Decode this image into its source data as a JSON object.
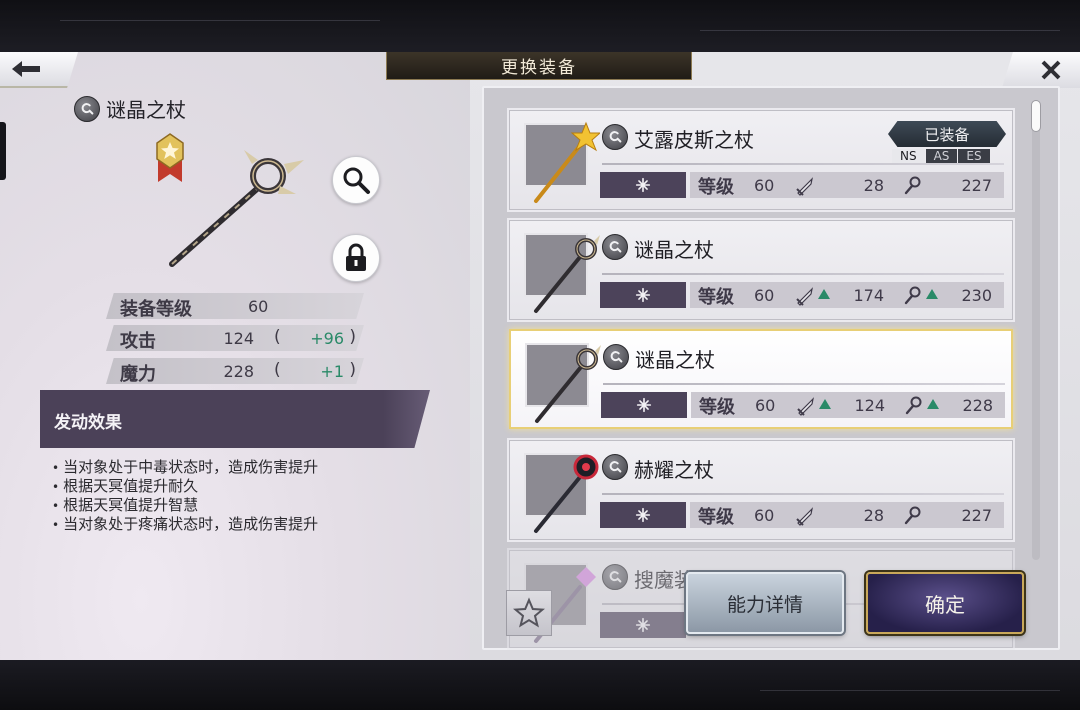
{
  "screen": {
    "title": "更换装备"
  },
  "selected_item": {
    "name": "谜晶之杖",
    "stats": [
      {
        "label": "装备等级",
        "value": "60",
        "diff": ""
      },
      {
        "label": "攻击",
        "value": "124",
        "diff": "+96"
      },
      {
        "label": "魔力",
        "value": "228",
        "diff": "+1"
      }
    ],
    "paren_open": "(",
    "paren_close": ")",
    "effect_title": "发动效果",
    "effects": [
      "当对象处于中毒状态时，造成伤害提升",
      "根据天冥值提升耐久",
      "根据天冥值提升智慧",
      "当对象处于疼痛状态时，造成伤害提升"
    ]
  },
  "list": {
    "items": [
      {
        "name": "艾露皮斯之杖",
        "level_label": "等级",
        "level": "60",
        "attack": "28",
        "magic": "227",
        "equipped_label": "已装备",
        "tags": [
          "NS",
          "AS",
          "ES"
        ]
      },
      {
        "name": "谜晶之杖",
        "level_label": "等级",
        "level": "60",
        "attack": "174",
        "magic": "230"
      },
      {
        "name": "谜晶之杖",
        "level_label": "等级",
        "level": "60",
        "attack": "124",
        "magic": "228"
      },
      {
        "name": "赫耀之杖",
        "level_label": "等级",
        "level": "60",
        "attack": "28",
        "magic": "227"
      },
      {
        "name": "搜魔装之杖"
      }
    ]
  },
  "buttons": {
    "detail": "能力详情",
    "confirm": "确定"
  },
  "icons": {
    "back": "back-arrow-icon",
    "close": "close-icon",
    "search": "magnifier-icon",
    "lock": "lock-icon",
    "favorite": "star-icon",
    "attack": "sword-icon",
    "magic": "staff-icon",
    "element": "sparkle-icon",
    "up": "up-arrow-icon"
  },
  "colors": {
    "accent_purple": "#4b4158",
    "gold_border": "#e8cf76",
    "positive_green": "#2a8a68"
  }
}
